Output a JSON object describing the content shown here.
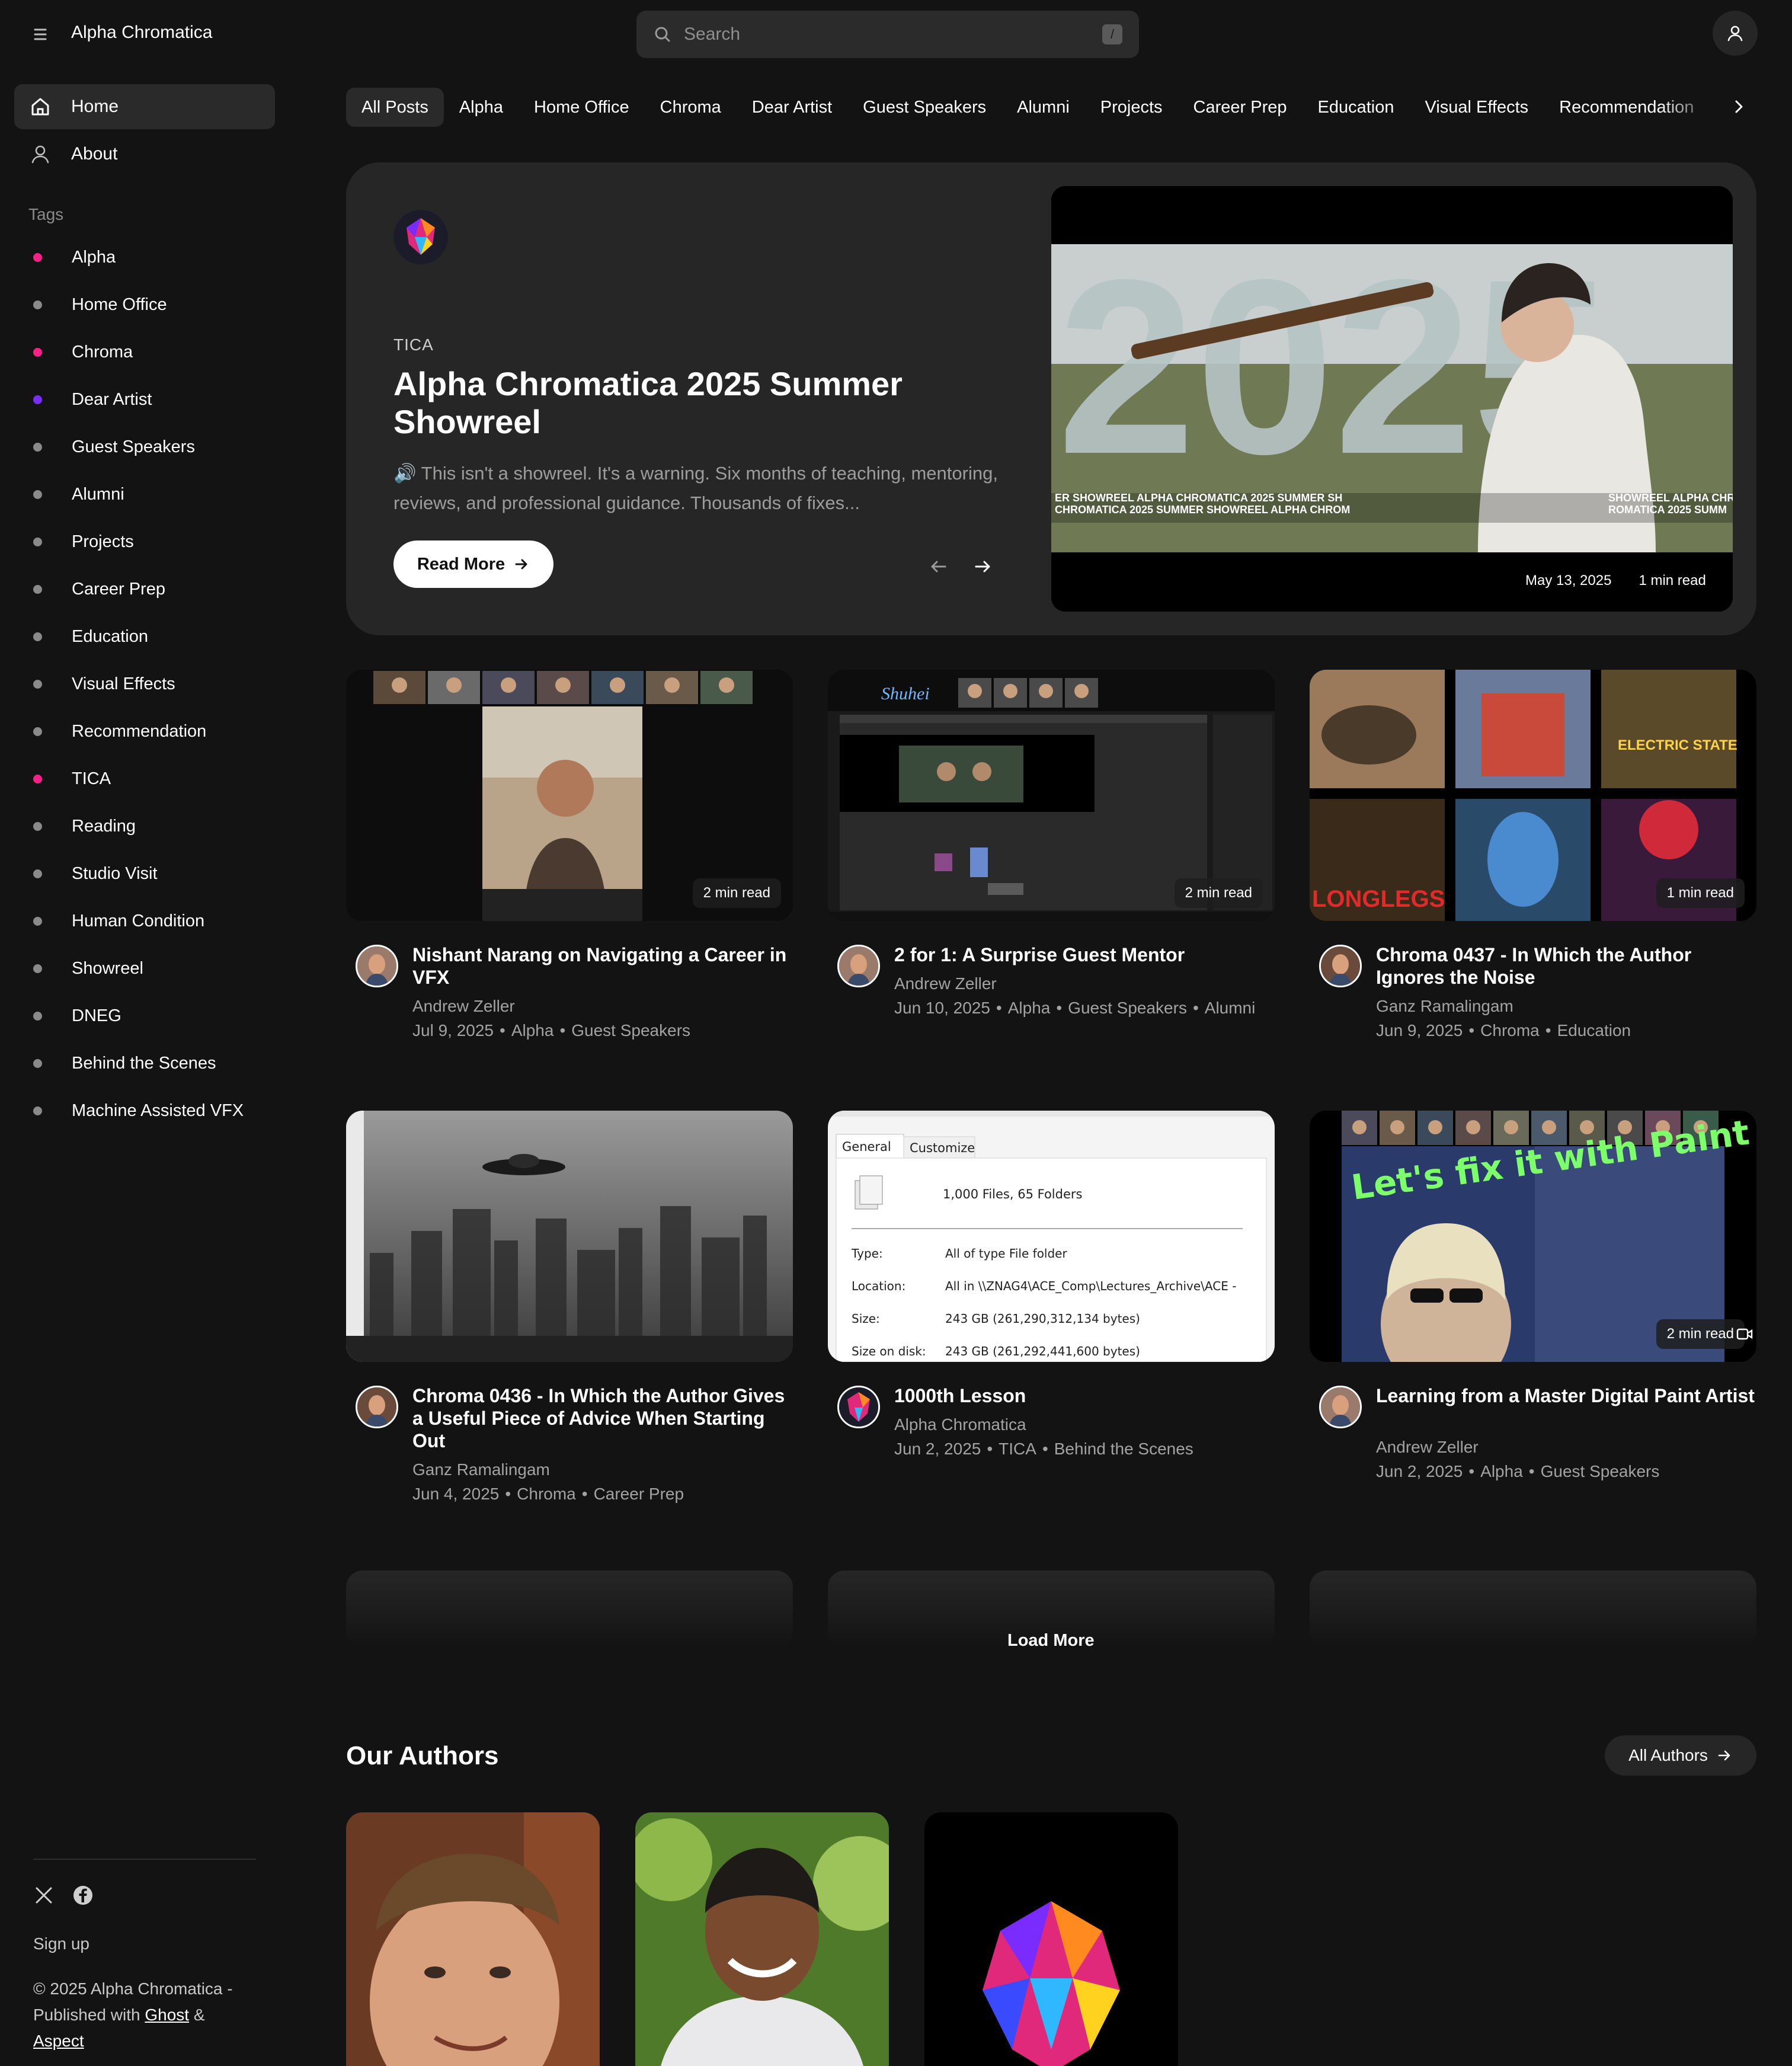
{
  "header": {
    "brand": "Alpha Chromatica",
    "search_placeholder": "Search",
    "search_shortcut": "/"
  },
  "sidebar": {
    "nav": [
      {
        "label": "Home",
        "icon": "home-icon",
        "active": true
      },
      {
        "label": "About",
        "icon": "user-icon",
        "active": false
      }
    ],
    "tags_title": "Tags",
    "tags": [
      {
        "label": "Alpha",
        "color": "#ff1f8a"
      },
      {
        "label": "Home Office",
        "color": "#8a8a8a"
      },
      {
        "label": "Chroma",
        "color": "#ff1f8a"
      },
      {
        "label": "Dear Artist",
        "color": "#7a2cff"
      },
      {
        "label": "Guest Speakers",
        "color": "#8a8a8a"
      },
      {
        "label": "Alumni",
        "color": "#8a8a8a"
      },
      {
        "label": "Projects",
        "color": "#8a8a8a"
      },
      {
        "label": "Career Prep",
        "color": "#8a8a8a"
      },
      {
        "label": "Education",
        "color": "#8a8a8a"
      },
      {
        "label": "Visual Effects",
        "color": "#8a8a8a"
      },
      {
        "label": "Recommendation",
        "color": "#8a8a8a"
      },
      {
        "label": "TICA",
        "color": "#ff1f8a"
      },
      {
        "label": "Reading",
        "color": "#8a8a8a"
      },
      {
        "label": "Studio Visit",
        "color": "#8a8a8a"
      },
      {
        "label": "Human Condition",
        "color": "#8a8a8a"
      },
      {
        "label": "Showreel",
        "color": "#8a8a8a"
      },
      {
        "label": "DNEG",
        "color": "#8a8a8a"
      },
      {
        "label": "Behind the Scenes",
        "color": "#8a8a8a"
      },
      {
        "label": "Machine Assisted VFX",
        "color": "#8a8a8a"
      }
    ],
    "footer": {
      "signup": "Sign up",
      "copyright_prefix": "© 2025 Alpha Chromatica - Published with",
      "ghost": "Ghost",
      "amp": "&",
      "aspect": "Aspect"
    }
  },
  "chips": [
    "All Posts",
    "Alpha",
    "Home Office",
    "Chroma",
    "Dear Artist",
    "Guest Speakers",
    "Alumni",
    "Projects",
    "Career Prep",
    "Education",
    "Visual Effects",
    "Recommendation"
  ],
  "hero": {
    "tag": "TICA",
    "title": "Alpha Chromatica 2025 Summer Showreel",
    "excerpt": "🔊 This isn't a showreel. It's a warning. Six months of teaching, mentoring, reviews, and professional guidance. Thousands of fixes...",
    "read_more": "Read More",
    "date": "May 13, 2025",
    "read_time": "1 min read",
    "image_text": "2025",
    "image_strip_left": "ER SHOWREEL ALPHA CHROMATICA 2025 SUMMER SH",
    "image_strip_left2": "CHROMATICA 2025 SUMMER SHOWREEL ALPHA CHROM",
    "image_strip_right": "SHOWREEL ALPHA CHR",
    "image_strip_right2": "ROMATICA 2025 SUMM"
  },
  "posts": [
    {
      "title": "Nishant Narang on Navigating a Career in VFX",
      "author": "Andrew Zeller",
      "date": "Jul 9, 2025",
      "tags": [
        "Alpha",
        "Guest Speakers"
      ],
      "read_time": "2 min read"
    },
    {
      "title": "2 for 1: A Surprise Guest Mentor",
      "author": "Andrew Zeller",
      "date": "Jun 10, 2025",
      "tags": [
        "Alpha",
        "Guest Speakers",
        "Alumni"
      ],
      "read_time": "2 min read"
    },
    {
      "title": "Chroma 0437 - In Which the Author Ignores the Noise",
      "author": "Ganz Ramalingam",
      "date": "Jun 9, 2025",
      "tags": [
        "Chroma",
        "Education"
      ],
      "read_time": "1 min read"
    },
    {
      "title": "Chroma 0436 - In Which the Author Gives a Useful Piece of Advice When Starting Out",
      "author": "Ganz Ramalingam",
      "date": "Jun 4, 2025",
      "tags": [
        "Chroma",
        "Career Prep"
      ],
      "read_time": ""
    },
    {
      "title": "1000th Lesson",
      "author": "Alpha Chromatica",
      "date": "Jun 2, 2025",
      "tags": [
        "TICA",
        "Behind the Scenes"
      ],
      "read_time": ""
    },
    {
      "title": "Learning from a Master Digital Paint Artist",
      "author": "Andrew Zeller",
      "date": "Jun 2, 2025",
      "tags": [
        "Alpha",
        "Guest Speakers"
      ],
      "read_time": "2 min read"
    }
  ],
  "post_images": {
    "p2_signature": "Shuhei",
    "p3_poster_text": "LONGLEGS",
    "p3_poster_text2": "ELECTRIC STATE",
    "p5_tab_general": "General",
    "p5_tab_customize": "Customize",
    "p5_files": "1,000 Files, 65 Folders",
    "p5_rows": [
      {
        "k": "Type:",
        "v": "All of type File folder"
      },
      {
        "k": "Location:",
        "v": "All in \\\\ZNAG4\\ACE_Comp\\Lectures_Archive\\ACE -"
      },
      {
        "k": "Size:",
        "v": "243 GB (261,290,312,134 bytes)"
      },
      {
        "k": "Size on disk:",
        "v": "243 GB (261,292,441,600 bytes)"
      }
    ],
    "p6_overlay": "Let's fix it with Paint"
  },
  "load_more": "Load More",
  "authors": {
    "title": "Our Authors",
    "all_label": "All Authors"
  },
  "colors": {
    "background": "#131313",
    "panel": "#262626",
    "accent_pink": "#ff1f8a",
    "accent_purple": "#7a2cff"
  }
}
